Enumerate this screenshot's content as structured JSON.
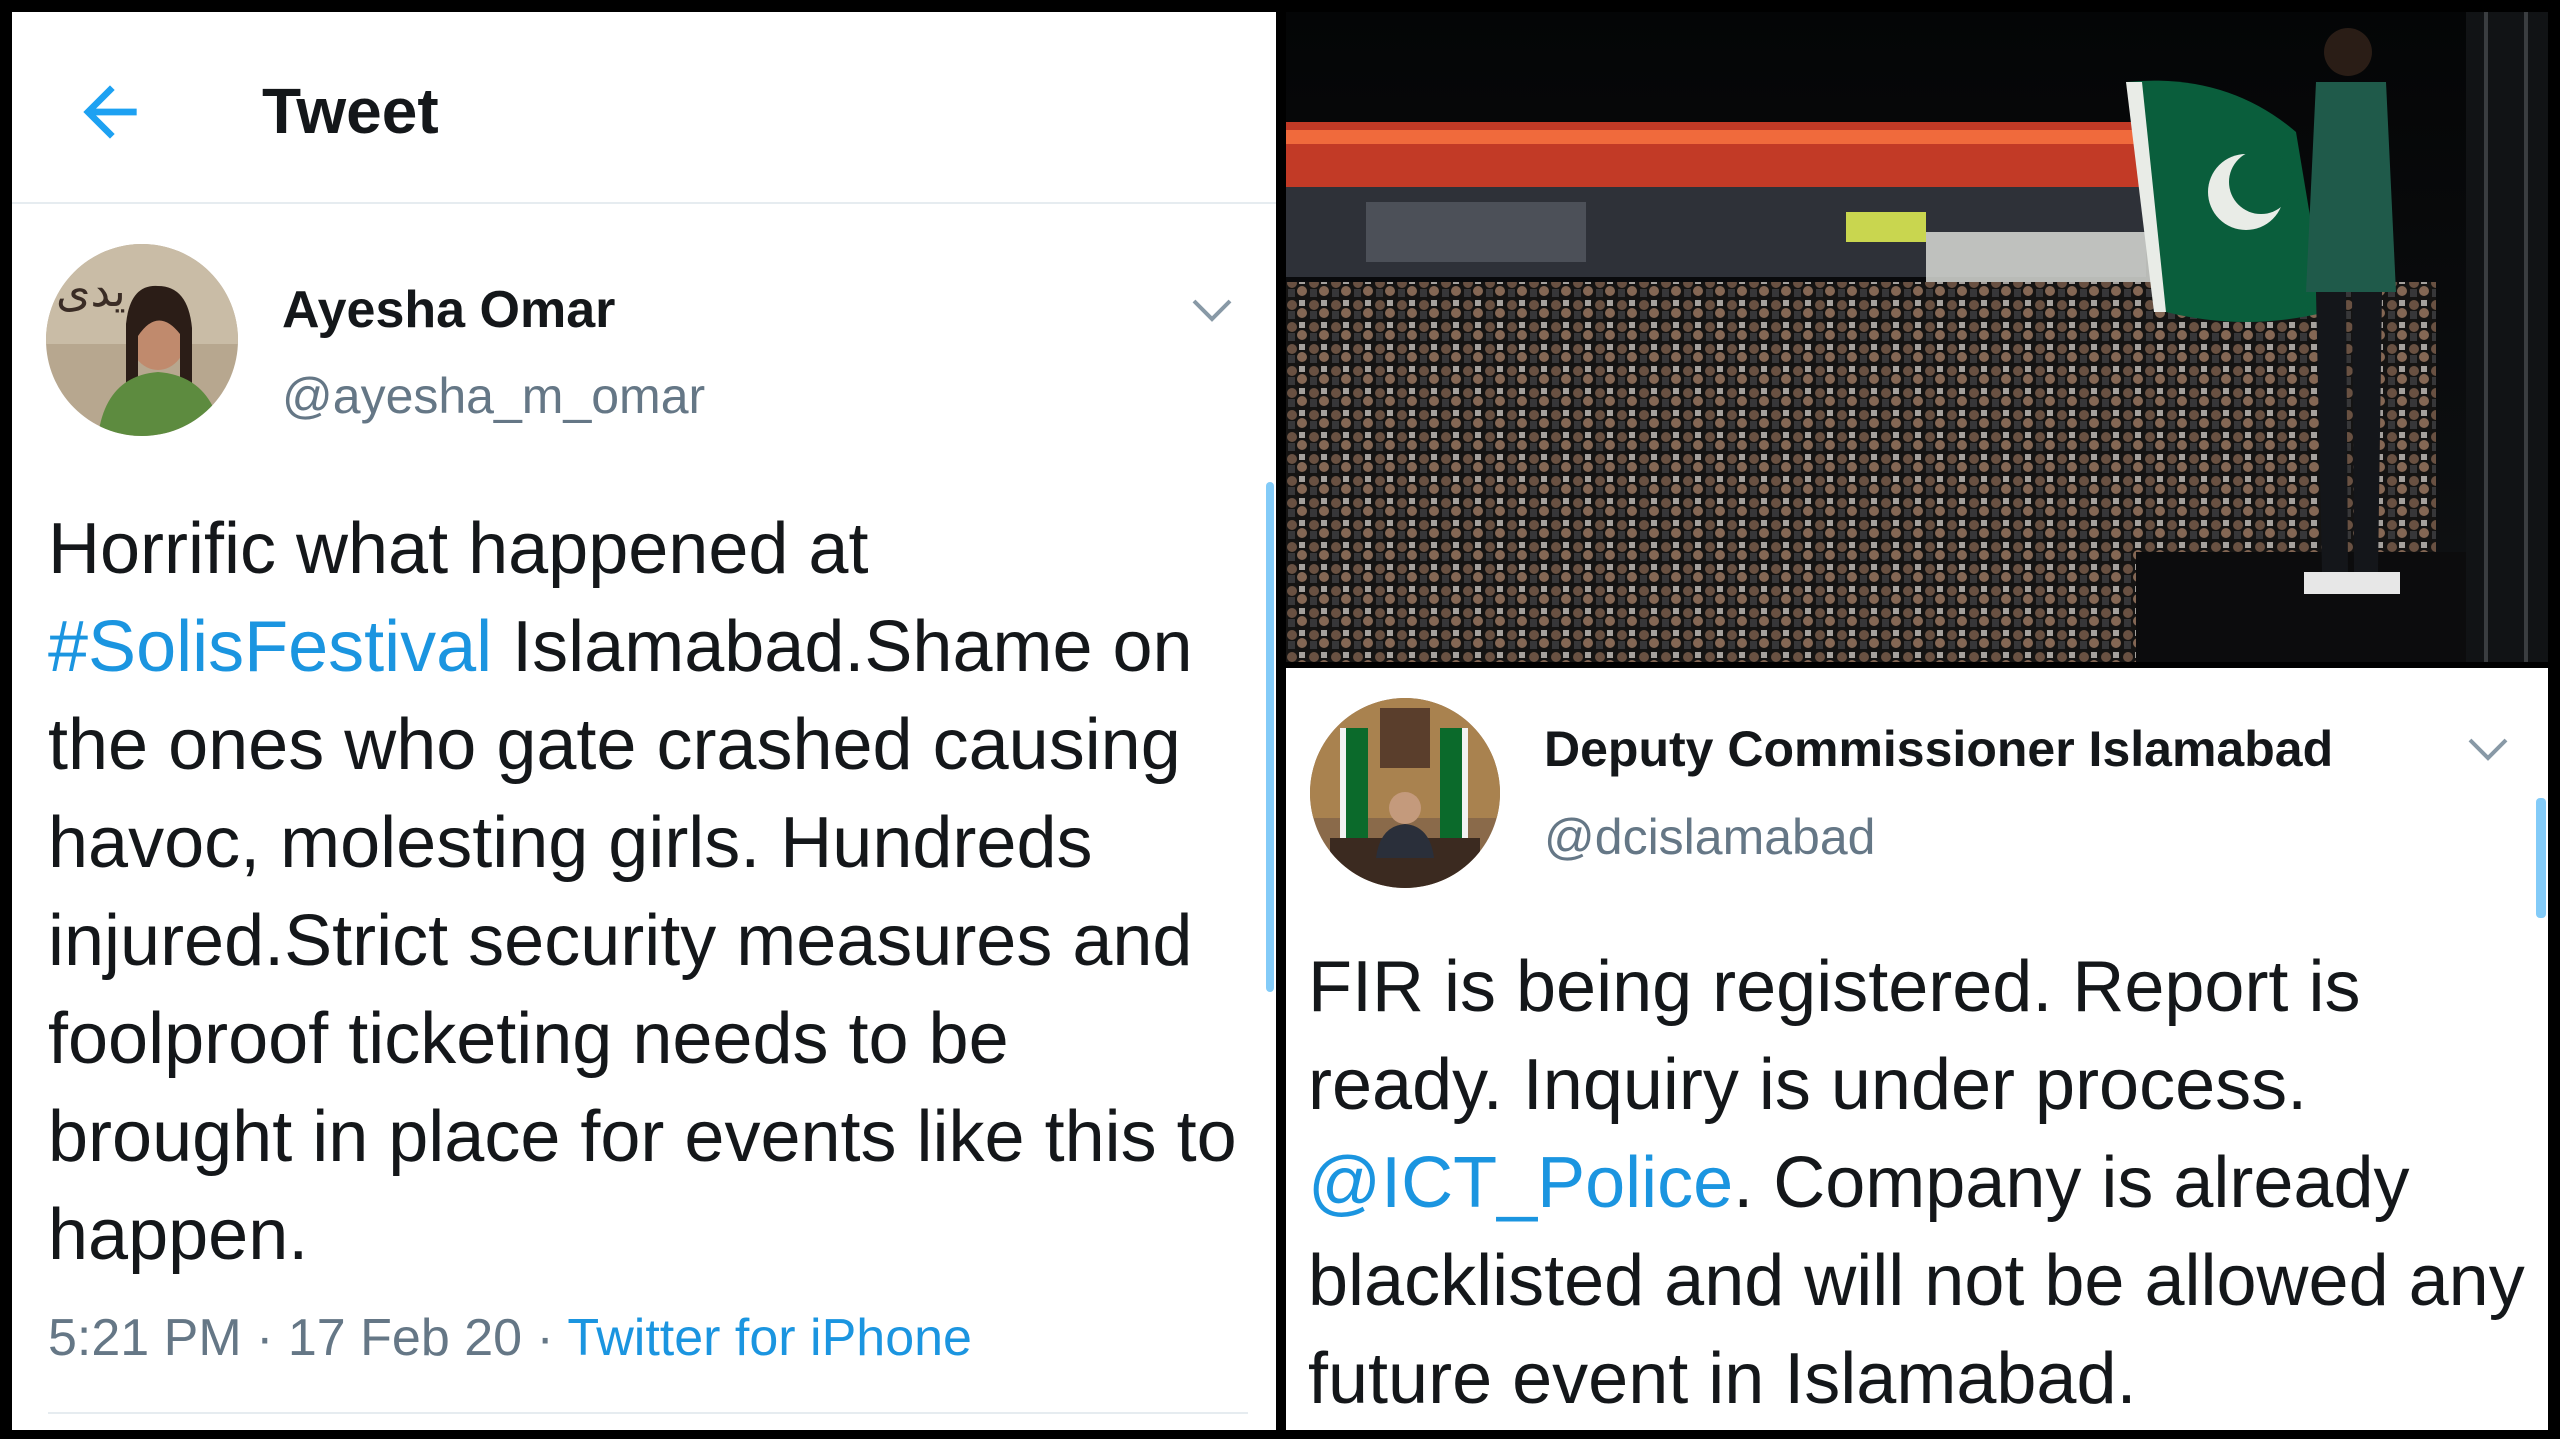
{
  "left_tweet": {
    "header_title": "Tweet",
    "author_name": "Ayesha Omar",
    "author_handle": "@ayesha_m_omar",
    "text_before_link": "Horrific what happened at ",
    "hashtag": "#SolisFestival",
    "text_after_link": " Islamabad.Shame on the ones who gate crashed causing havoc, molesting girls. Hundreds injured.Strict security measures and foolproof ticketing needs to be brought in place for events like this to happen.",
    "time": "5:21 PM",
    "separator": " · ",
    "date": "17 Feb 20",
    "app": "Twitter for iPhone",
    "avatar_sign_text": "یدی"
  },
  "right_tweet": {
    "author_name": "Deputy Commissioner Islamabad",
    "author_handle": "@dcislamabad",
    "text_before_link": "FIR is being registered. Report is ready. Inquiry is under process. ",
    "mention": "@ICT_Police",
    "text_after_link": ". Company is already blacklisted and will not be allowed any future event in Islamabad."
  },
  "icons": {
    "back": "back-arrow-icon",
    "chevron": "chevron-down-icon"
  },
  "colors": {
    "link": "#1b95e0",
    "text": "#14171a",
    "secondary": "#657786",
    "background": "#ffffff",
    "stage_lights": "#d2402a",
    "flag_green": "#01411c"
  }
}
